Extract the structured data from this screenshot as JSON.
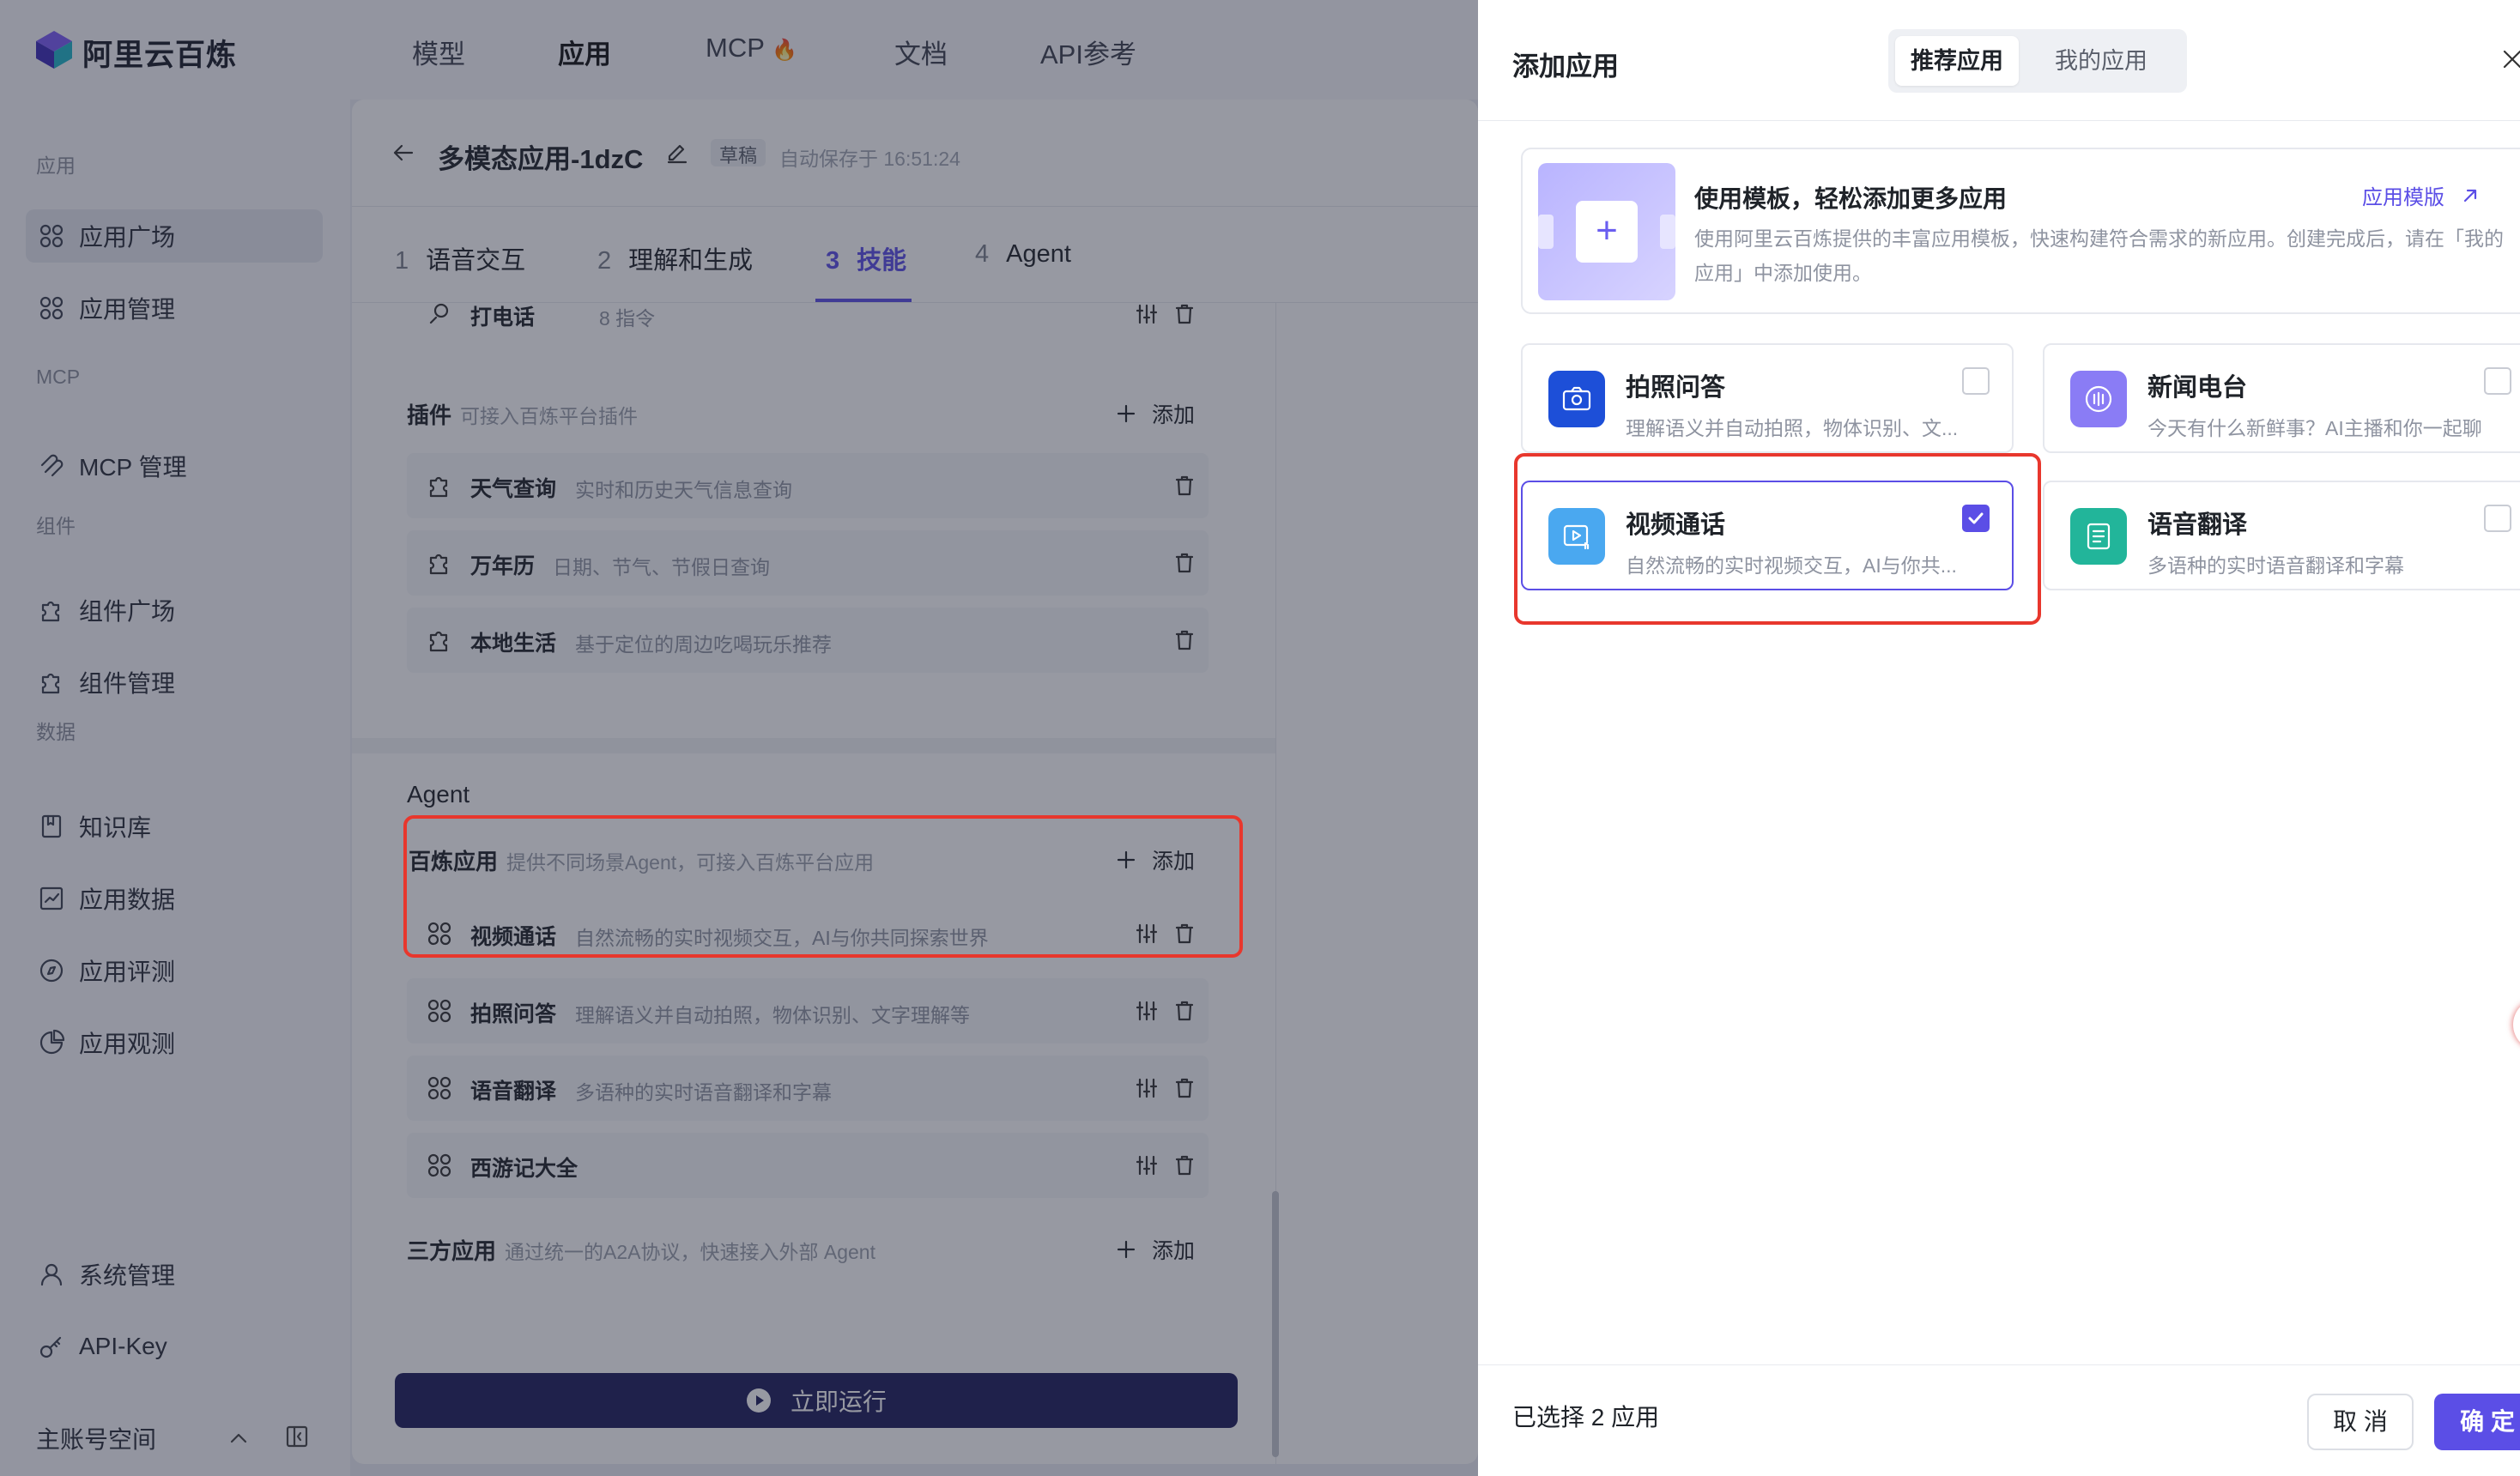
{
  "brand": {
    "name": "阿里云百炼"
  },
  "topnav": {
    "items": [
      "模型",
      "应用",
      "MCP",
      "文档",
      "API参考"
    ],
    "active": "应用",
    "mcp_badge": "🔥"
  },
  "sidebar": {
    "sections": {
      "app": "应用",
      "mcp": "MCP",
      "component": "组件",
      "data": "数据"
    },
    "items": {
      "app_square": "应用广场",
      "app_manage": "应用管理",
      "mcp_manage": "MCP 管理",
      "comp_square": "组件广场",
      "comp_manage": "组件管理",
      "kb": "知识库",
      "app_data": "应用数据",
      "app_eval": "应用评测",
      "app_obs": "应用观测",
      "sys_manage": "系统管理",
      "api_key": "API-Key"
    },
    "account": "主账号空间"
  },
  "editor": {
    "title": "多模态应用-1dzC",
    "draft": "草稿",
    "autosave": "自动保存于 16:51:24",
    "steps": [
      {
        "n": "1",
        "label": "语音交互"
      },
      {
        "n": "2",
        "label": "理解和生成"
      },
      {
        "n": "3",
        "label": "技能"
      },
      {
        "n": "4",
        "label": "Agent"
      }
    ],
    "call_row": {
      "name": "打电话",
      "desc": "8 指令"
    },
    "plugins": {
      "title": "插件",
      "hint": "可接入百炼平台插件",
      "add": "添加",
      "rows": [
        {
          "name": "天气查询",
          "desc": "实时和历史天气信息查询"
        },
        {
          "name": "万年历",
          "desc": "日期、节气、节假日查询"
        },
        {
          "name": "本地生活",
          "desc": "基于定位的周边吃喝玩乐推荐"
        }
      ]
    },
    "agent": {
      "title": "Agent",
      "bailian": {
        "title": "百炼应用",
        "hint": "提供不同场景Agent，可接入百炼平台应用",
        "add": "添加"
      },
      "rows": [
        {
          "name": "视频通话",
          "desc": "自然流畅的实时视频交互，AI与你共同探索世界"
        },
        {
          "name": "拍照问答",
          "desc": "理解语义并自动拍照，物体识别、文字理解等"
        },
        {
          "name": "语音翻译",
          "desc": "多语种的实时语音翻译和字幕"
        },
        {
          "name": "西游记大全",
          "desc": ""
        }
      ],
      "third": {
        "title": "三方应用",
        "hint": "通过统一的A2A协议，快速接入外部 Agent",
        "add": "添加"
      }
    },
    "run": "立即运行"
  },
  "drawer": {
    "title": "添加应用",
    "tabs": [
      "推荐应用",
      "我的应用"
    ],
    "active_tab": "推荐应用",
    "template": {
      "title": "使用模板，轻松添加更多应用",
      "desc": "使用阿里云百炼提供的丰富应用模板，快速构建符合需求的新应用。创建完成后，请在「我的应用」中添加使用。",
      "link": "应用模版"
    },
    "cards": [
      {
        "name": "拍照问答",
        "desc": "理解语义并自动拍照，物体识别、文...",
        "icon": "camera-icon",
        "color": "#1d4fd8",
        "checked": false
      },
      {
        "name": "新闻电台",
        "desc": "今天有什么新鲜事？AI主播和你一起聊",
        "icon": "radio-icon",
        "color": "#8a7cf5",
        "checked": false
      },
      {
        "name": "视频通话",
        "desc": "自然流畅的实时视频交互，AI与你共...",
        "icon": "video-icon",
        "color": "#4aa8f0",
        "checked": true
      },
      {
        "name": "语音翻译",
        "desc": "多语种的实时语音翻译和字幕",
        "icon": "translate-icon",
        "color": "#22b59a",
        "checked": false
      }
    ],
    "selected_count": "已选择 2 应用",
    "cancel": "取 消",
    "ok": "确 定"
  },
  "colors": {
    "accent": "#5b4ee6",
    "highlight": "#e8372d",
    "run_button": "#1e1d5c"
  }
}
